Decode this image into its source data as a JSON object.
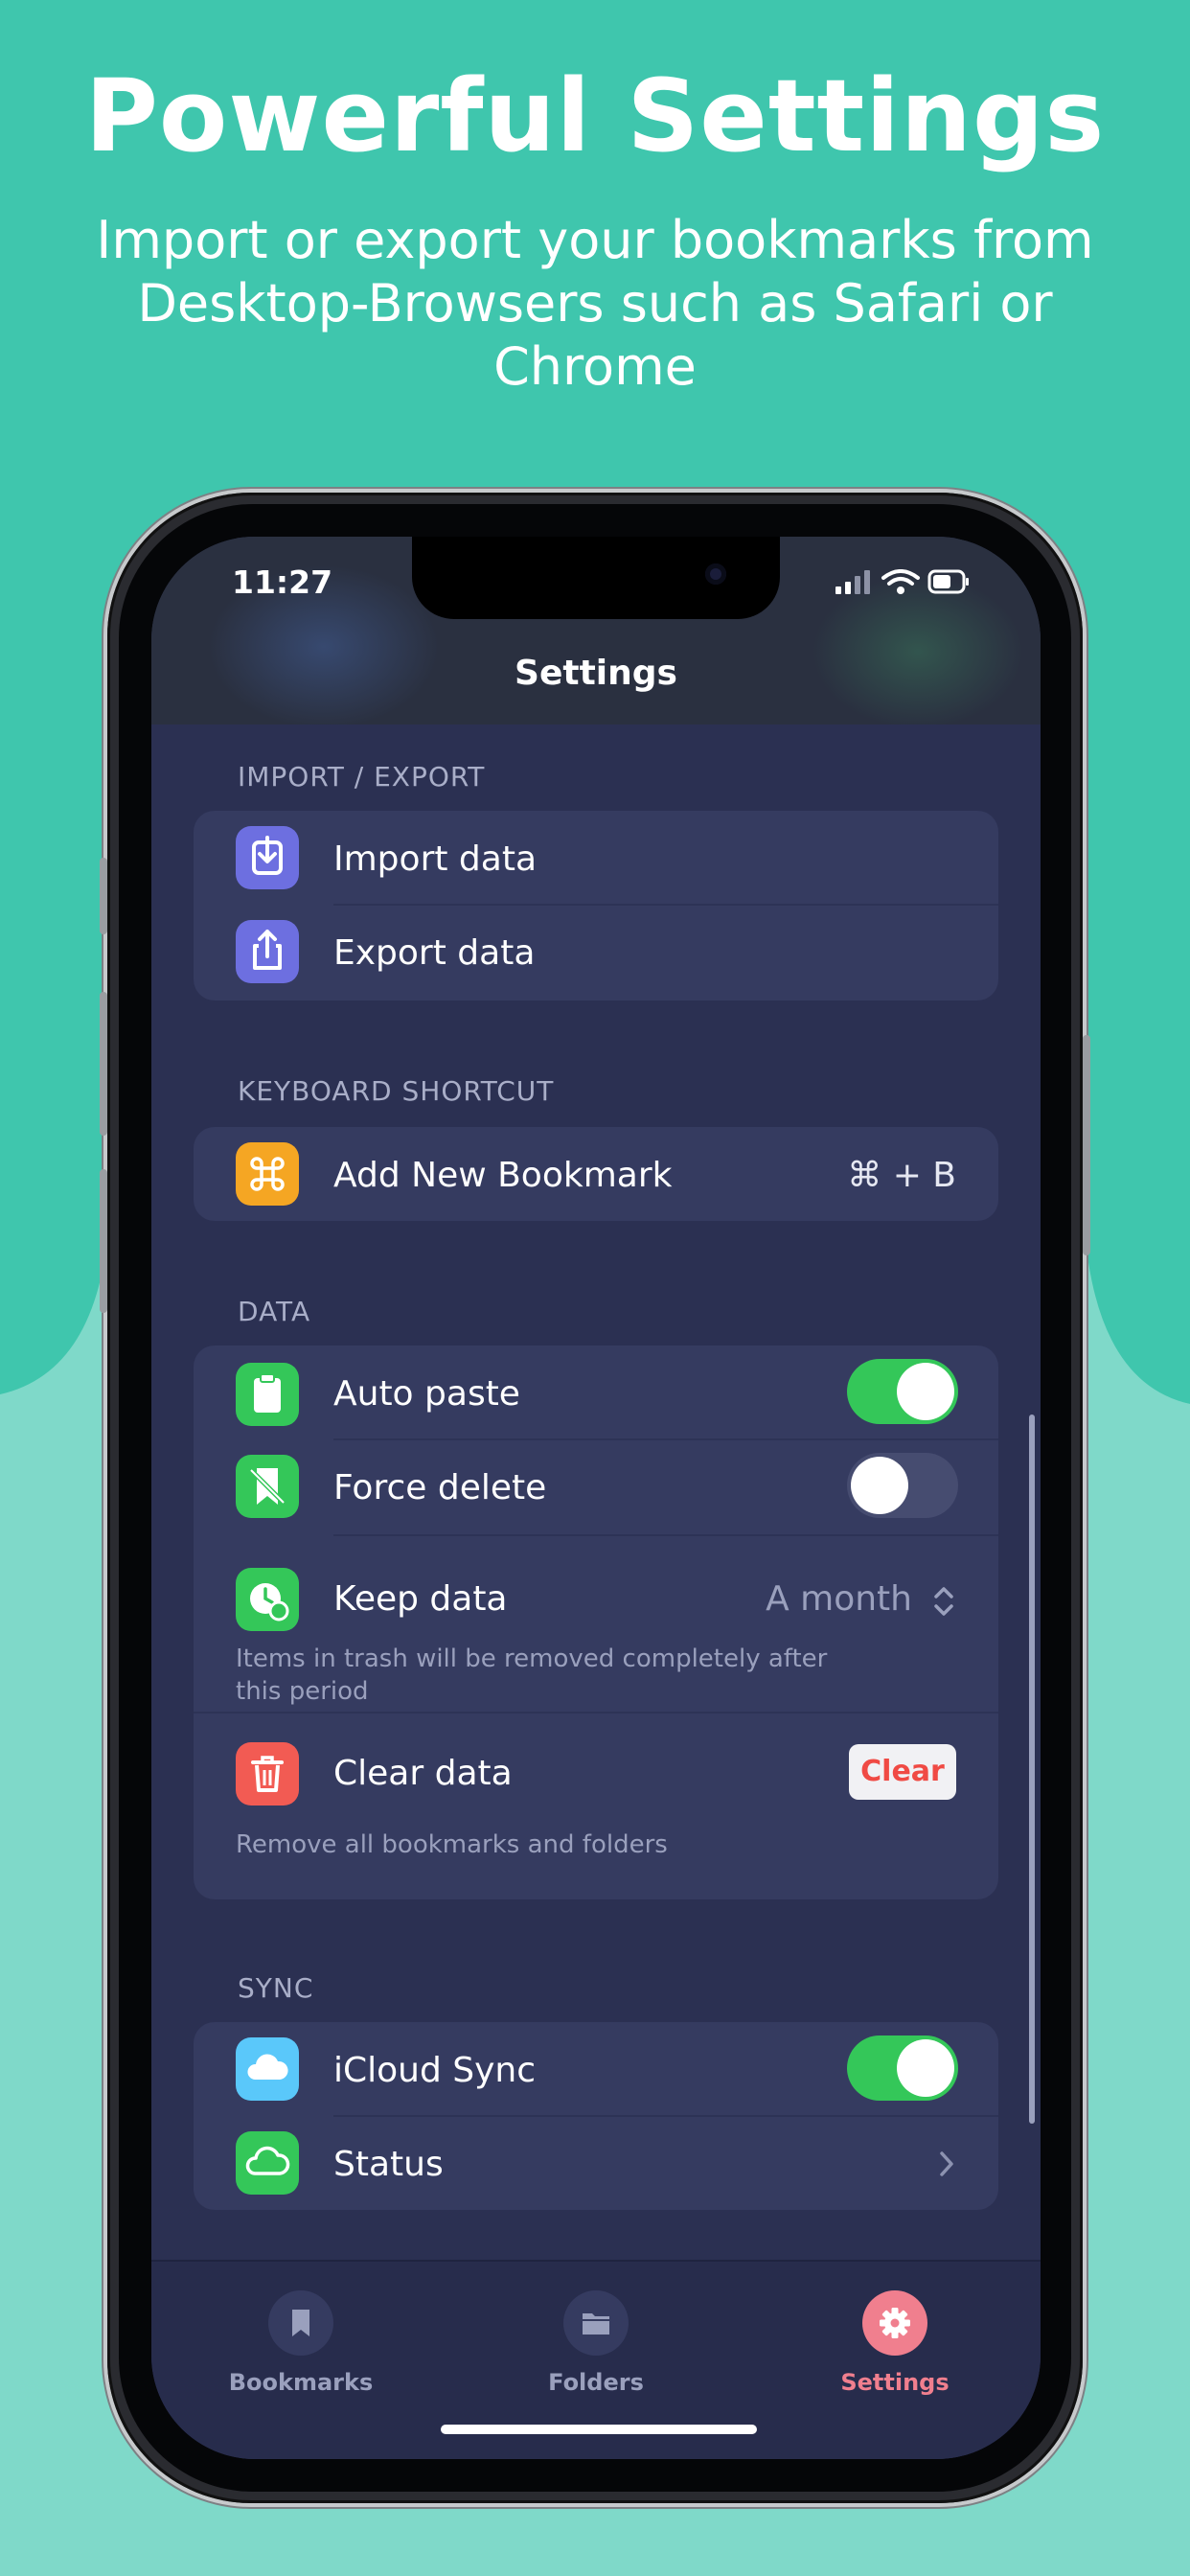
{
  "hero": {
    "title": "Powerful Settings",
    "subtitle": "Import or export your bookmarks from Desktop-Browsers such as Safari or Chrome"
  },
  "status_bar": {
    "time": "11:27"
  },
  "nav": {
    "title": "Settings"
  },
  "sections": {
    "import_export": {
      "header": "IMPORT / EXPORT",
      "import_label": "Import data",
      "export_label": "Export data"
    },
    "keyboard": {
      "header": "KEYBOARD SHORTCUT",
      "add_label": "Add New Bookmark",
      "shortcut": "⌘ + B"
    },
    "data": {
      "header": "DATA",
      "auto_paste_label": "Auto paste",
      "auto_paste_on": true,
      "force_delete_label": "Force delete",
      "force_delete_on": false,
      "keep_label": "Keep data",
      "keep_value": "A month",
      "keep_note": "Items in trash will be removed completely after this period",
      "clear_label": "Clear data",
      "clear_button": "Clear",
      "clear_note": "Remove all bookmarks and folders"
    },
    "sync": {
      "header": "SYNC",
      "icloud_label": "iCloud Sync",
      "icloud_on": true,
      "status_label": "Status"
    }
  },
  "tabs": [
    {
      "label": "Bookmarks",
      "icon": "bookmark-icon",
      "active": false
    },
    {
      "label": "Folders",
      "icon": "folder-icon",
      "active": false
    },
    {
      "label": "Settings",
      "icon": "gear-icon",
      "active": true
    }
  ],
  "colors": {
    "background": "#3fc6ad",
    "background_lower": "#7fd9c9",
    "screen": "#2b3052",
    "group": "#353b60",
    "toggle_on": "#34c759",
    "accent_tab": "#f07f8e",
    "clear_text": "#f04a44"
  }
}
